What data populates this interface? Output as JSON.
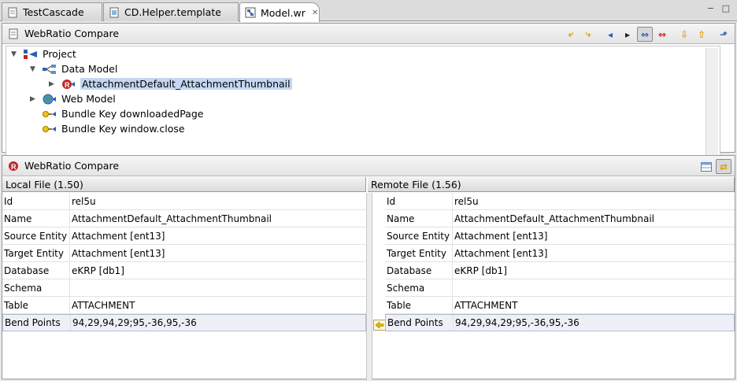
{
  "tabs": [
    {
      "label": "TestCascade",
      "icon": "document-icon"
    },
    {
      "label": "CD.Helper.template",
      "icon": "template-document-icon"
    },
    {
      "label": "Model.wr",
      "icon": "webratio-model-icon"
    }
  ],
  "window_controls": "− □",
  "top_panel": {
    "title": "WebRatio Compare",
    "toolbar": [
      "copy-left-icon",
      "copy-right-icon",
      "previous-diff-icon",
      "next-diff-icon",
      "bidirectional-icon",
      "conflict-icon",
      "next-change-icon",
      "previous-change-icon",
      "export-icon"
    ]
  },
  "tree": {
    "nodes": [
      {
        "label": "Project",
        "icon": "project-icon",
        "expanded": true
      },
      {
        "label": "Data Model",
        "icon": "data-model-icon",
        "expanded": true
      },
      {
        "label": "AttachmentDefault_AttachmentThumbnail",
        "icon": "relationship-icon",
        "expanded": false,
        "selected": true
      },
      {
        "label": "Web Model",
        "icon": "web-model-icon",
        "expanded": false
      },
      {
        "label": "Bundle Key downloadedPage",
        "icon": "bundle-key-icon"
      },
      {
        "label": "Bundle Key window.close",
        "icon": "bundle-key-icon"
      }
    ]
  },
  "bottom_panel": {
    "title": "WebRatio Compare",
    "toolbar": [
      "layout-icon",
      "swap-icon"
    ]
  },
  "local": {
    "header": "Local File (1.50)",
    "rows": [
      {
        "key": "Id",
        "value": "rel5u"
      },
      {
        "key": "Name",
        "value": "AttachmentDefault_AttachmentThumbnail"
      },
      {
        "key": "Source Entity",
        "value": "Attachment [ent13]"
      },
      {
        "key": "Target Entity",
        "value": "Attachment [ent13]"
      },
      {
        "key": "Database",
        "value": "eKRP [db1]"
      },
      {
        "key": "Schema",
        "value": ""
      },
      {
        "key": "Table",
        "value": "ATTACHMENT"
      },
      {
        "key": "Bend Points",
        "value": "94,29,94,29;95,-36,95,-36"
      }
    ]
  },
  "remote": {
    "header": "Remote File (1.56)",
    "rows": [
      {
        "key": "Id",
        "value": "rel5u"
      },
      {
        "key": "Name",
        "value": "AttachmentDefault_AttachmentThumbnail"
      },
      {
        "key": "Source Entity",
        "value": "Attachment [ent13]"
      },
      {
        "key": "Target Entity",
        "value": "Attachment [ent13]"
      },
      {
        "key": "Database",
        "value": "eKRP [db1]"
      },
      {
        "key": "Schema",
        "value": ""
      },
      {
        "key": "Table",
        "value": "ATTACHMENT"
      },
      {
        "key": "Bend Points",
        "value": "94,29,94,29;95,-36,95,-36"
      }
    ]
  }
}
